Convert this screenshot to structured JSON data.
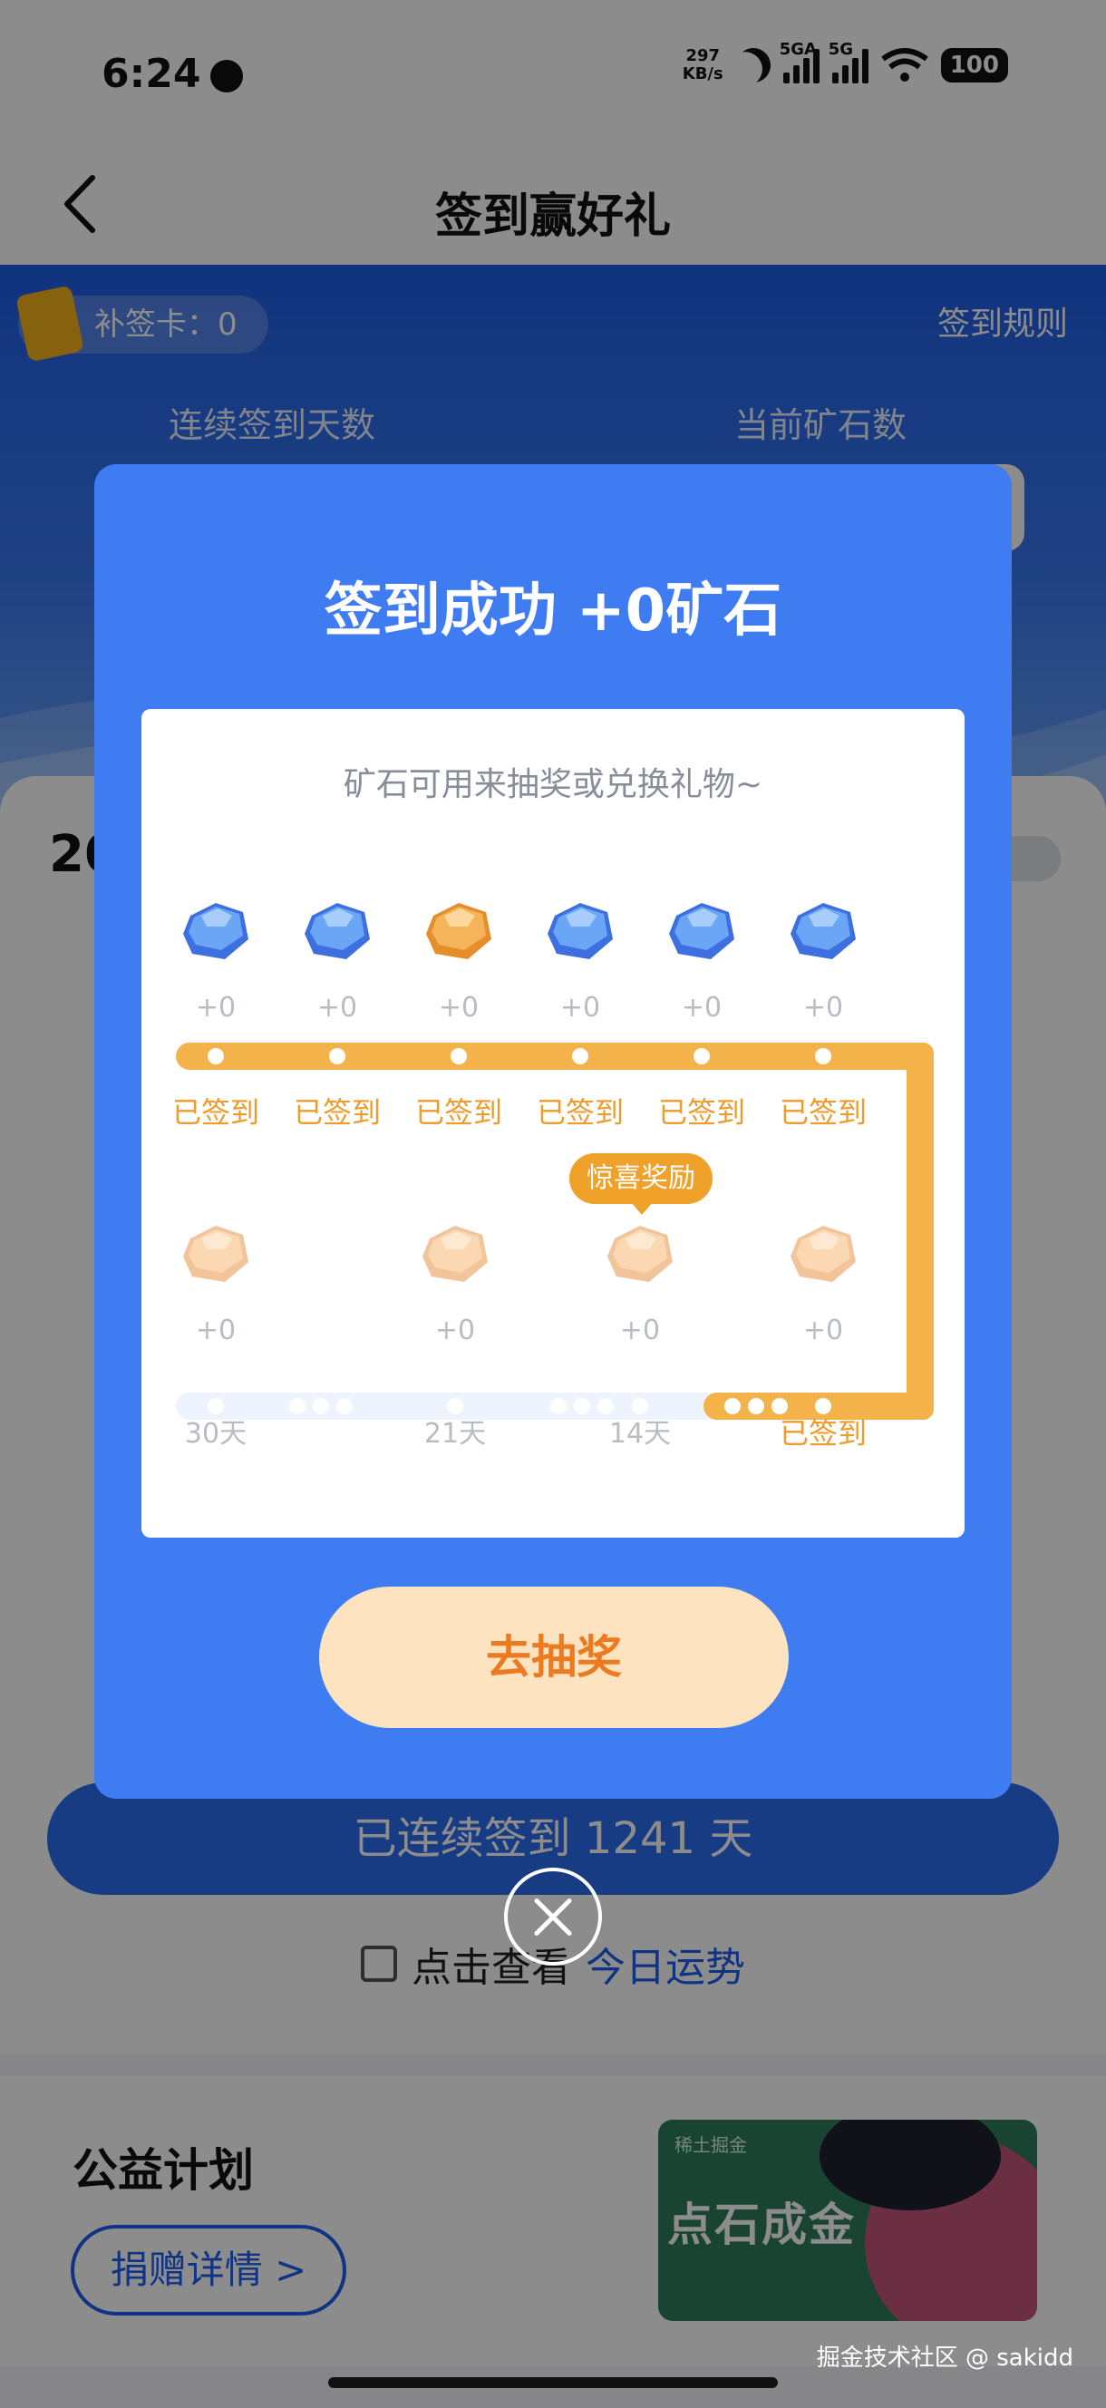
{
  "status_bar": {
    "time": "6:24",
    "net_speed_value": "297",
    "net_speed_unit": "KB/s",
    "sim1_label": "5GA",
    "sim2_label": "5G",
    "battery": "100"
  },
  "nav": {
    "title": "签到赢好礼"
  },
  "header": {
    "makeup_card": "补签卡：0",
    "rules_link": "签到规则",
    "streak_days_label": "连续签到天数",
    "ore_count_label": "当前矿石数"
  },
  "calendar": {
    "year_prefix": "20",
    "streak_text": "已连续签到 1241 天",
    "fortune_prefix": "点击查看",
    "fortune_link": "今日运势"
  },
  "charity": {
    "title": "公益计划",
    "donate_button": "捐赠详情 >",
    "banner_brand": "稀土掘金",
    "banner_text": "点石成金"
  },
  "modal": {
    "title": "签到成功 +0矿石",
    "subtitle": "矿石可用来抽奖或兑换礼物~",
    "row1": [
      {
        "amount": "+0",
        "status": "已签到",
        "gem": "blue"
      },
      {
        "amount": "+0",
        "status": "已签到",
        "gem": "blue"
      },
      {
        "amount": "+0",
        "status": "已签到",
        "gem": "orange"
      },
      {
        "amount": "+0",
        "status": "已签到",
        "gem": "blue"
      },
      {
        "amount": "+0",
        "status": "已签到",
        "gem": "blue"
      },
      {
        "amount": "+0",
        "status": "已签到",
        "gem": "blue"
      }
    ],
    "row2": [
      {
        "amount": "+0",
        "label": "30天"
      },
      {
        "amount": "+0",
        "label": "21天"
      },
      {
        "amount": "+0",
        "label": "14天"
      },
      {
        "amount": "+0",
        "label": "已签到"
      }
    ],
    "surprise_tag": "惊喜奖励",
    "lottery_button": "去抽奖"
  },
  "watermark": "掘金技术社区 @ sakidd",
  "colors": {
    "modal_blue": "#3f7cf2",
    "track_orange": "#f3b24a",
    "button_peach": "#fde3bf",
    "button_text_orange": "#ec7a20",
    "link_blue": "#1e60f0"
  }
}
